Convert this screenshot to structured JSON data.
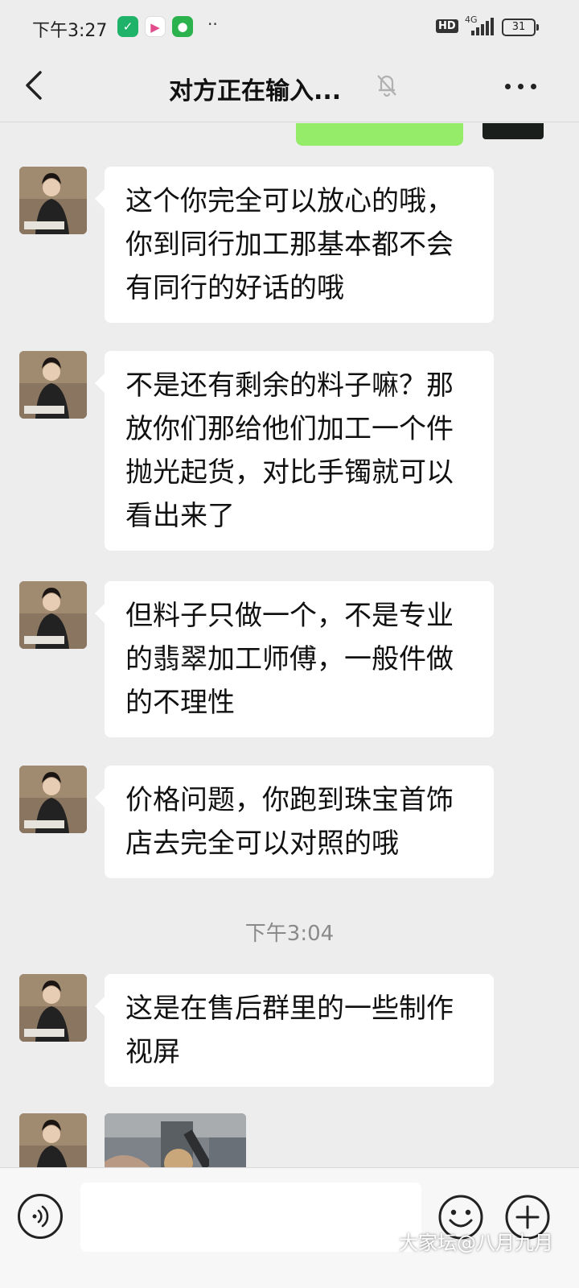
{
  "status_bar": {
    "time": "下午3:27",
    "hd": "HD",
    "network": "4G",
    "battery": "31"
  },
  "header": {
    "title": "对方正在输入...",
    "icons": {
      "back": "chevron-left-icon",
      "mute": "bell-off-icon",
      "more": "more-dots-icon"
    }
  },
  "messages": [
    {
      "text": "这个你完全可以放心的哦，你到同行加工那基本都不会有同行的好话的哦"
    },
    {
      "text": "不是还有剩余的料子嘛？那放你们那给他们加工一个件抛光起货，对比手镯就可以看出来了"
    },
    {
      "text": "但料子只做一个，不是专业的翡翠加工师傅，一般件做的不理性"
    },
    {
      "text": "价格问题，你跑到珠宝首饰店去完全可以对照的哦"
    },
    {
      "text": "这是在售后群里的一些制作视屏"
    }
  ],
  "time_divider": "下午3:04",
  "input_bar": {
    "placeholder": "",
    "icons": {
      "voice": "voice-icon",
      "emoji": "emoji-icon",
      "plus": "plus-icon"
    }
  },
  "watermark": "大家坛@八月九月",
  "colors": {
    "background": "#ededed",
    "bubble_other": "#ffffff",
    "bubble_self": "#95ec69",
    "time_text": "#8a8a8a"
  }
}
